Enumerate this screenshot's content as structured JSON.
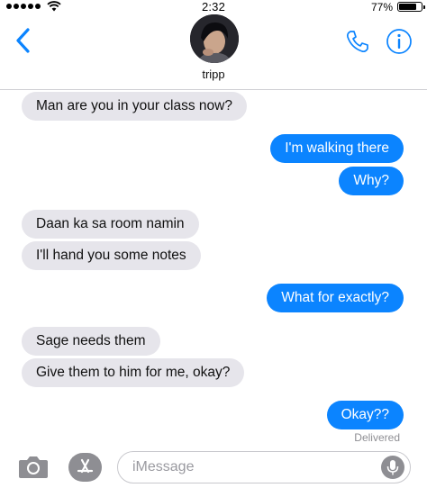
{
  "status_bar": {
    "time": "2:32",
    "battery_percent": "77%",
    "battery_level": 0.77,
    "signal_bars": 5
  },
  "header": {
    "contact_name": "tripp",
    "back_icon": "chevron-left-icon",
    "phone_icon": "phone-icon",
    "info_icon": "info-icon"
  },
  "messages": [
    {
      "direction": "incoming",
      "text": "Man are you in your class now?"
    },
    {
      "direction": "outgoing",
      "text": "I'm walking there"
    },
    {
      "direction": "outgoing",
      "text": "Why?"
    },
    {
      "direction": "incoming",
      "text": "Daan ka sa room namin"
    },
    {
      "direction": "incoming",
      "text": "I'll hand you some notes"
    },
    {
      "direction": "outgoing",
      "text": "What for exactly?"
    },
    {
      "direction": "incoming",
      "text": "Sage needs them"
    },
    {
      "direction": "incoming",
      "text": "Give them to him for me, okay?"
    },
    {
      "direction": "outgoing",
      "text": "Okay??"
    }
  ],
  "delivered_label": "Delivered",
  "composer": {
    "placeholder": "iMessage",
    "camera_icon": "camera-icon",
    "apps_icon": "app-store-icon",
    "mic_icon": "microphone-icon"
  },
  "colors": {
    "outgoing_bubble": "#0b84ff",
    "incoming_bubble": "#e6e5eb",
    "accent": "#0b84ff"
  }
}
